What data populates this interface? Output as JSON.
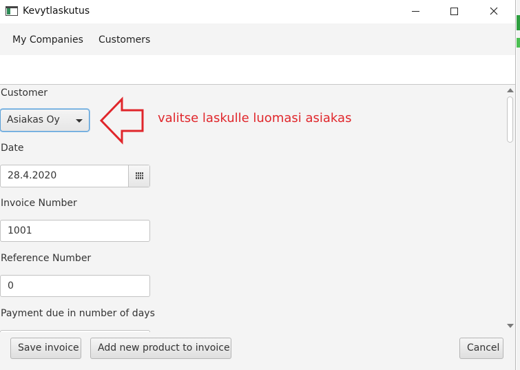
{
  "window": {
    "title": "Kevytlaskutus",
    "controls": {
      "minimize": "—",
      "maximize": "☐",
      "close": "✕"
    }
  },
  "menu": {
    "items": [
      {
        "label": "My Companies"
      },
      {
        "label": "Customers"
      }
    ]
  },
  "form": {
    "customer": {
      "label": "Customer",
      "selected": "Asiakas Oy"
    },
    "date": {
      "label": "Date",
      "value": "28.4.2020"
    },
    "invoice_number": {
      "label": "Invoice Number",
      "value": "1001"
    },
    "reference_number": {
      "label": "Reference Number",
      "value": "0"
    },
    "payment_due": {
      "label": "Payment due in number of days"
    }
  },
  "annotation": {
    "text": "valitse laskulle luomasi asiakas",
    "color": "#e0262b"
  },
  "buttons": {
    "save": "Save invoice",
    "add_product": "Add new product to invoice",
    "cancel": "Cancel"
  },
  "icons": [
    "app-icon",
    "calendar-icon",
    "dropdown-arrow-icon",
    "arrow-left-icon"
  ]
}
